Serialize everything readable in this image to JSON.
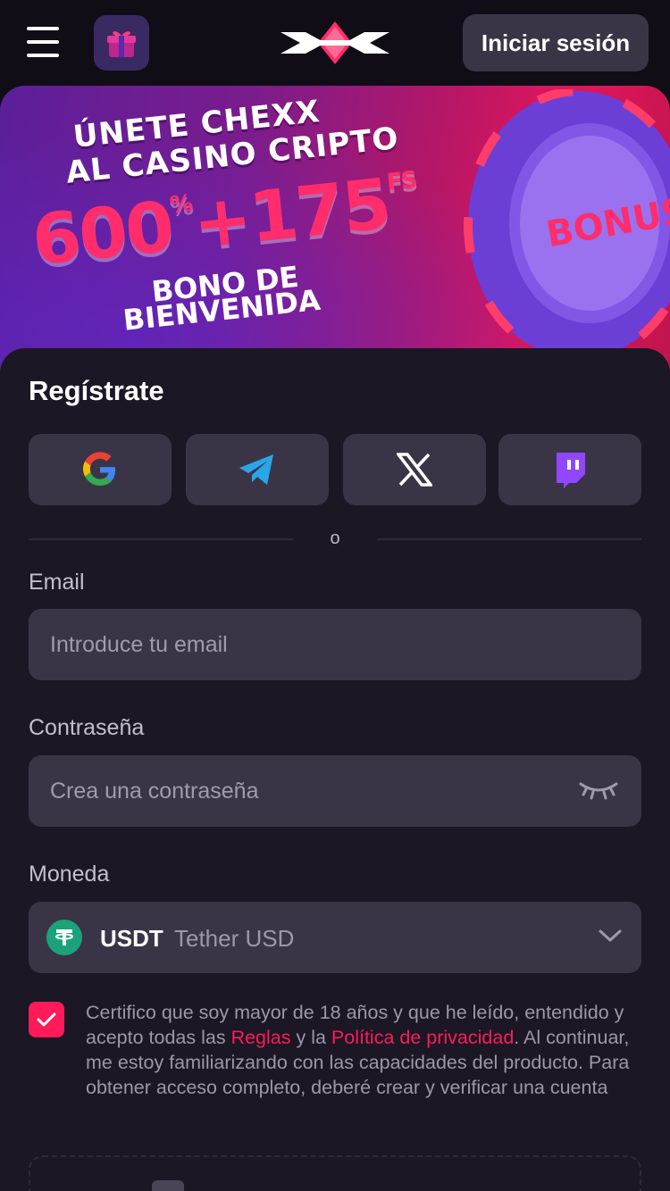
{
  "header": {
    "login_label": "Iniciar sesión"
  },
  "banner": {
    "line1": "ÚNETE CHEXX",
    "line2": "AL CASINO CRIPTO",
    "big_percent": "600",
    "percent_sup": "%",
    "plus": "+175",
    "fs_sup": "FS",
    "line3": "BONO DE",
    "line4": "BIENVENIDA",
    "chip_text": "BONUS"
  },
  "register": {
    "title": "Regístrate",
    "social": [
      "google-icon",
      "telegram-icon",
      "x-icon",
      "twitch-icon"
    ],
    "or_text": "o",
    "email_label": "Email",
    "email_placeholder": "Introduce tu email",
    "password_label": "Contraseña",
    "password_placeholder": "Crea una contraseña",
    "currency_label": "Moneda",
    "currency_code": "USDT",
    "currency_name": "Tether USD",
    "terms_part1": "Certifico que soy mayor de 18 años y que he leído, entendido y acepto todas las ",
    "terms_rules": "Reglas",
    "terms_part2": " y la ",
    "terms_privacy": "Política de privacidad",
    "terms_part3": ". Al continuar, me estoy familiarizando con las capacidades del producto. Para obtener acceso completo, deberé crear y verificar una cuenta",
    "terms_checked": true
  },
  "colors": {
    "accent": "#ff1a5a",
    "background": "#100d17",
    "card": "#1b1724",
    "input": "#3a3546"
  }
}
